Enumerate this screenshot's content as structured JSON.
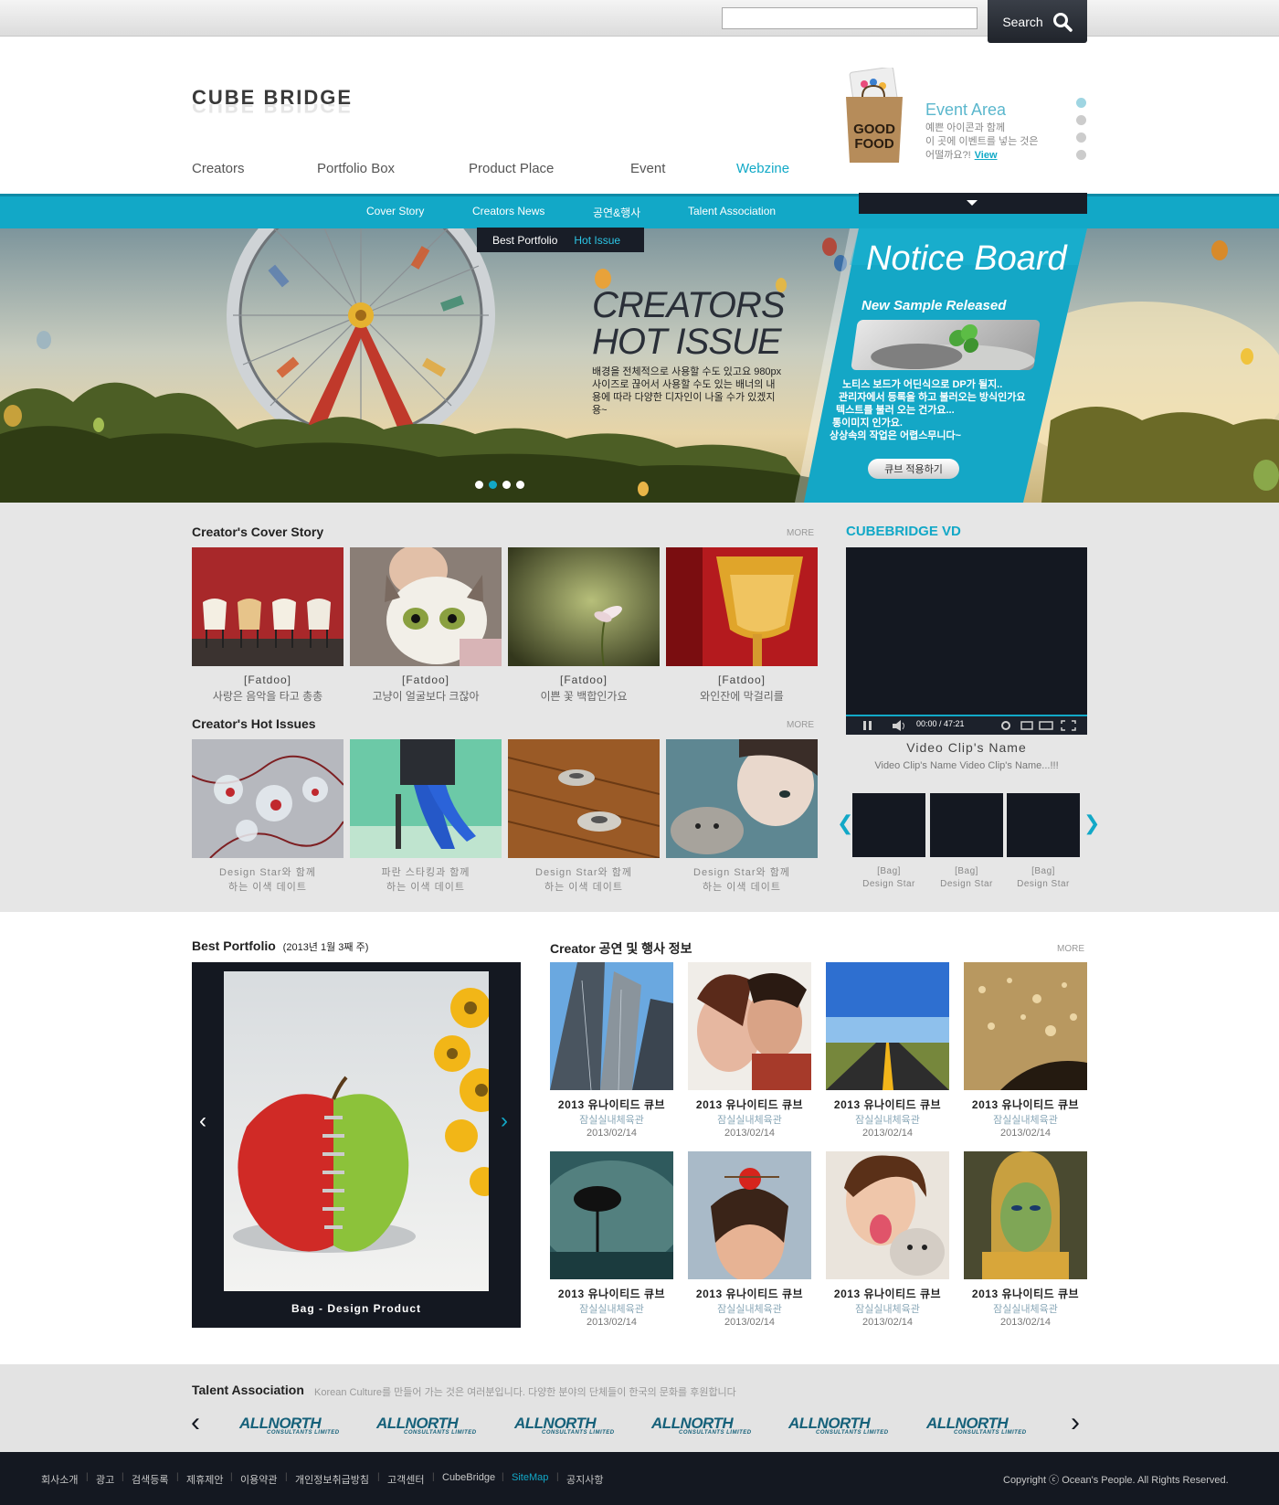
{
  "header": {
    "search_placeholder": "",
    "search_label": "Search",
    "logo": "CUBE BRIDGE",
    "nav": [
      "Creators",
      "Portfolio Box",
      "Product Place",
      "Event",
      "Webzine"
    ],
    "active_nav": "Webzine"
  },
  "event": {
    "bag_text_1": "GOOD",
    "bag_text_2": "FOOD",
    "title": "Event Area",
    "line1": "예쁜 아이콘과 함께",
    "line2": "이 곳에 이벤트를 넣는 것은",
    "line3": "어떨까요?!",
    "view": "View"
  },
  "subnav": {
    "items": [
      "Cover Story",
      "Creators News",
      "공연&행사",
      "Talent Association"
    ],
    "dropdown": [
      "Best Portfolio",
      "Hot Issue"
    ]
  },
  "hero": {
    "title1": "CREATORS",
    "title2": "HOT ISSUE",
    "desc": "배경을 전체적으로 사용할 수도 있고요 980px 사이즈로 끊어서 사용할 수도 있는 배너의 내용에 따라 다양한 디자인이 나올 수가 있겠지용~"
  },
  "notice": {
    "title": "Notice Board",
    "subtitle": "New Sample Released",
    "l1": "노티스 보드가 어딘식으로 DP가 될지..",
    "l2": "관리자에서 등록을 하고 불러오는 방식인가요",
    "l3": "텍스트를 불러 오는 건가요...",
    "l4": "통이미지 인가요.",
    "l5": "상상속의 작업은 어렵스무니다~",
    "button": "큐브 적용하기"
  },
  "cover_story": {
    "title": "Creator's Cover Story",
    "more": "MORE",
    "items": [
      {
        "tag": "[Fatdoo]",
        "text": "사랑은 음악을 타고 총총"
      },
      {
        "tag": "[Fatdoo]",
        "text": "고냥이 얼굴보다 크잖아"
      },
      {
        "tag": "[Fatdoo]",
        "text": "이쁜 꽃 백합인가요"
      },
      {
        "tag": "[Fatdoo]",
        "text": "와인잔에 막걸리를"
      }
    ]
  },
  "hot_issues": {
    "title": "Creator's Hot Issues",
    "more": "MORE",
    "items": [
      {
        "l1": "Design Star와 함께",
        "l2": "하는 이색 데이트"
      },
      {
        "l1": "파란 스타킹과 함께",
        "l2": "하는 이색 데이트"
      },
      {
        "l1": "Design Star와 함께",
        "l2": "하는 이색 데이트"
      },
      {
        "l1": "Design Star와 함께",
        "l2": "하는 이색 데이트"
      }
    ]
  },
  "vd": {
    "title": "CUBEBRIDGE VD",
    "time": "00:00 / 47:21",
    "clip_name": "Video Clip's Name",
    "clip_desc": "Video Clip's Name Video Clip's Name...!!!",
    "thumbs": [
      {
        "l1": "[Bag]",
        "l2": "Design Star"
      },
      {
        "l1": "[Bag]",
        "l2": "Design Star"
      },
      {
        "l1": "[Bag]",
        "l2": "Design Star"
      }
    ]
  },
  "best_portfolio": {
    "title": "Best Portfolio",
    "week": "(2013년 1월 3째 주)",
    "caption": "Bag - Design Product"
  },
  "events": {
    "title": "Creator 공연 및 행사 정보",
    "more": "MORE",
    "items": [
      {
        "t": "2013 유나이티드 큐브",
        "p": "잠실실내체육관",
        "d": "2013/02/14"
      },
      {
        "t": "2013 유나이티드 큐브",
        "p": "잠실실내체육관",
        "d": "2013/02/14"
      },
      {
        "t": "2013 유나이티드 큐브",
        "p": "잠실실내체육관",
        "d": "2013/02/14"
      },
      {
        "t": "2013 유나이티드 큐브",
        "p": "잠실실내체육관",
        "d": "2013/02/14"
      },
      {
        "t": "2013 유나이티드 큐브",
        "p": "잠실실내체육관",
        "d": "2013/02/14"
      },
      {
        "t": "2013 유나이티드 큐브",
        "p": "잠실실내체육관",
        "d": "2013/02/14"
      },
      {
        "t": "2013 유나이티드 큐브",
        "p": "잠실실내체육관",
        "d": "2013/02/14"
      },
      {
        "t": "2013 유나이티드 큐브",
        "p": "잠실실내체육관",
        "d": "2013/02/14"
      }
    ]
  },
  "talent": {
    "title": "Talent Association",
    "desc": "Korean Culture를 만들어 가는 것은 여러분입니다. 다양한 분야의 단체들이 한국의 문화를 후원합니다",
    "logo": "ALLNORTH",
    "logo_sub": "CONSULTANTS LIMITED"
  },
  "footer": {
    "links": [
      "회사소개",
      "광고",
      "검색등록",
      "제휴제안",
      "이용약관",
      "개인정보취급방침",
      "고객센터",
      "CubeBridge",
      "SiteMap",
      "공지사항"
    ],
    "copyright": "Copyright ⓒ Ocean's People. All Rights Reserved."
  },
  "colors": {
    "accent": "#12a8c7",
    "dark": "#141821",
    "band": "#e6e6e6"
  }
}
